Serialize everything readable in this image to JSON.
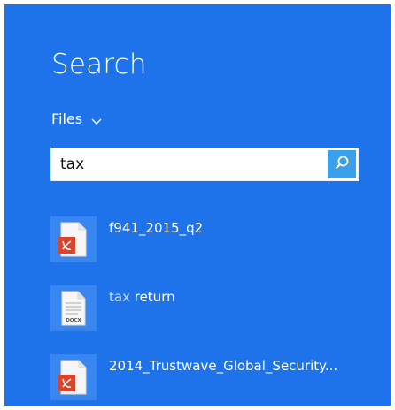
{
  "search_pane": {
    "title": "Search",
    "scope_label": "Files",
    "query_value": "tax",
    "results": [
      {
        "name": "f941_2015_q2",
        "file_type": "pdf",
        "icon": "pdf-file-icon"
      },
      {
        "match_text": "tax",
        "rest_text": "return",
        "file_type": "docx",
        "icon_badge": "DOCX",
        "icon": "docx-file-icon"
      },
      {
        "name": "2014_Trustwave_Global_Security...",
        "file_type": "pdf",
        "icon": "pdf-file-icon"
      }
    ]
  },
  "colors": {
    "panel_bg": "#1f73ea",
    "search_button": "#39a0e9",
    "pdf_red": "#d8452b"
  }
}
